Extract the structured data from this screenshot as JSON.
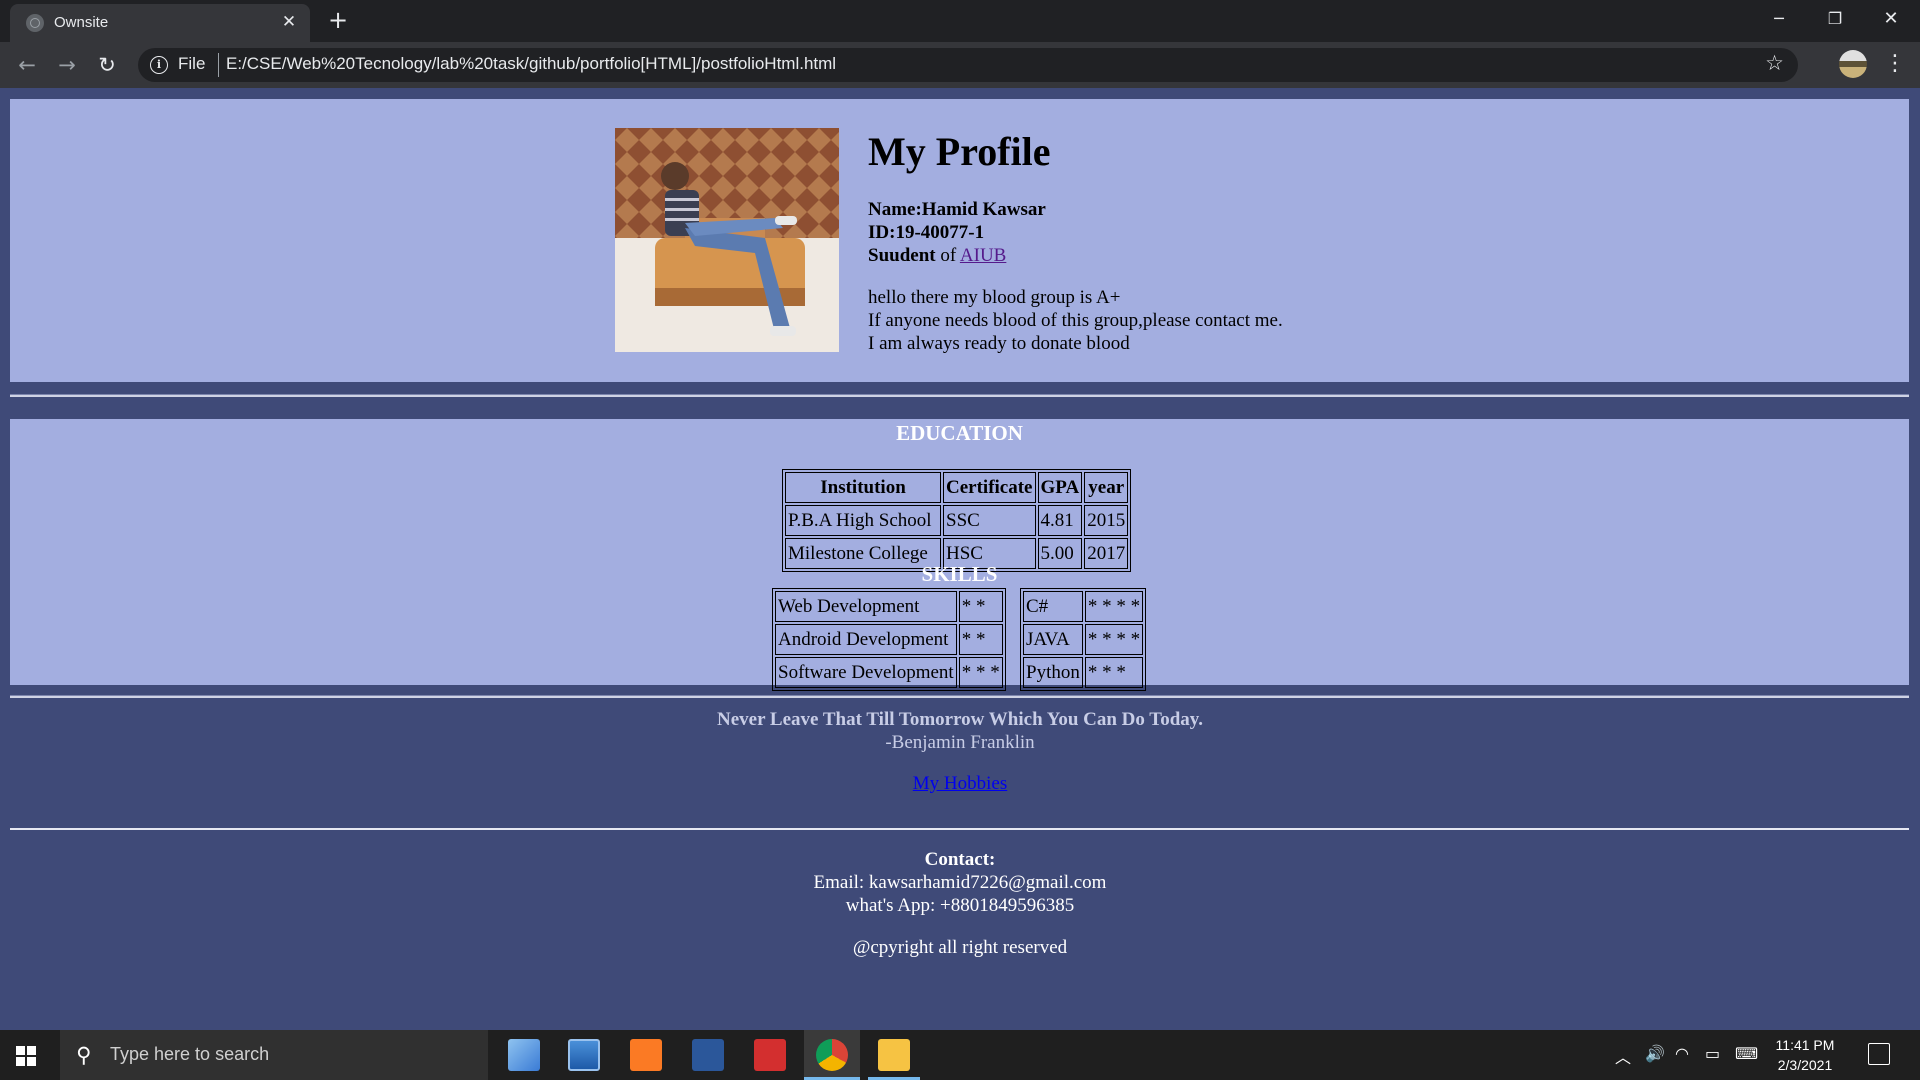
{
  "browser": {
    "tab_title": "Ownsite",
    "url_scheme": "File",
    "url": "E:/CSE/Web%20Tecnology/lab%20task/github/portfolio[HTML]/postfolioHtml.html"
  },
  "profile": {
    "heading": "My Profile",
    "name": "Name:Hamid Kawsar",
    "id": "ID:19-40077-1",
    "student_label": "Suudent",
    "of_text": " of ",
    "university_link": "AIUB",
    "blood_lines": [
      "hello there my blood group is A+",
      "If anyone needs blood of this group,please contact me.",
      "I am always ready to donate blood"
    ]
  },
  "education": {
    "heading": "EDUCATION",
    "columns": [
      "Institution",
      "Certificate",
      "GPA",
      "year"
    ],
    "rows": [
      [
        "P.B.A High School",
        "SSC",
        "4.81",
        "2015"
      ],
      [
        "Milestone College",
        "HSC",
        "5.00",
        "2017"
      ]
    ]
  },
  "skills": {
    "heading": "SKILLS",
    "left": [
      [
        "Web Development",
        "* *"
      ],
      [
        "Android Development",
        "* *"
      ],
      [
        "Software Development",
        "* * *"
      ]
    ],
    "right": [
      [
        "C#",
        "* * * *"
      ],
      [
        "JAVA",
        "* * * *"
      ],
      [
        "Python",
        "* * *"
      ]
    ]
  },
  "quote": {
    "text": "Never Leave That Till Tomorrow Which You Can Do Today.",
    "author": "-Benjamin Franklin",
    "hobbies_link": "My Hobbies"
  },
  "contact": {
    "title": "Contact:",
    "email": "Email: kawsarhamid7226@gmail.com",
    "whatsapp": "what's App: +8801849596385",
    "copyright": "@cpyright all right reserved"
  },
  "taskbar": {
    "search_placeholder": "Type here to search",
    "time": "11:41 PM",
    "date": "2/3/2021"
  },
  "colors": {
    "section_bg": "#a3aee0",
    "page_bg": "#3f4a78",
    "visited_link": "#551a8b",
    "link": "#0000ee"
  }
}
